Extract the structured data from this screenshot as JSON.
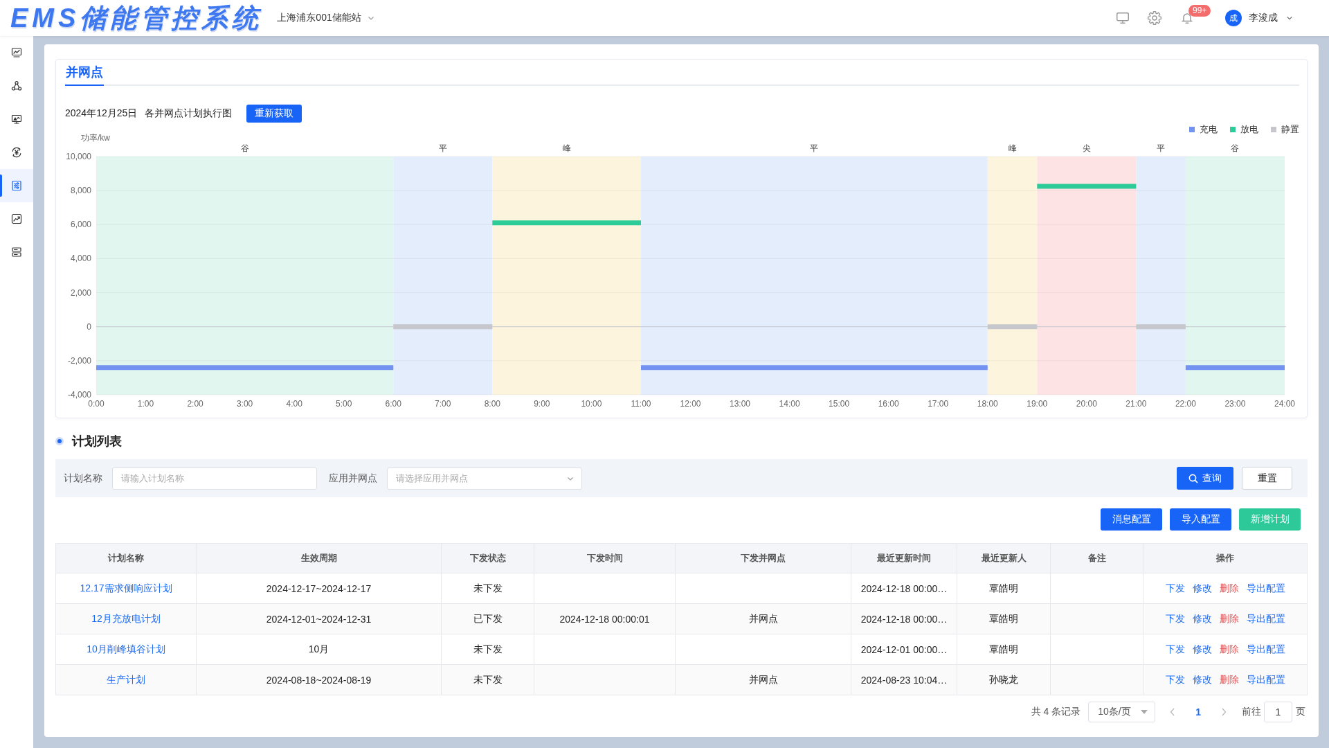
{
  "header": {
    "logo": "EMS储能管控系统",
    "station": "上海浦东001储能站",
    "notification_badge": "99+",
    "user": {
      "avatar": "成",
      "name": "李浚成"
    }
  },
  "sidebar": {
    "items": [
      {
        "selected": false
      },
      {
        "selected": false
      },
      {
        "selected": false
      },
      {
        "selected": false
      },
      {
        "selected": true
      },
      {
        "selected": false
      },
      {
        "selected": false
      }
    ]
  },
  "chart_panel": {
    "tabs": [
      {
        "label": "并网点",
        "selected": true
      }
    ],
    "date": "2024年12月25日",
    "subtitle": "各并网点计划执行图",
    "refresh_button": "重新获取",
    "chart_data": {
      "type": "line",
      "ylabel": "功率/kw",
      "x": [
        0,
        1,
        2,
        3,
        4,
        5,
        6,
        7,
        8,
        9,
        10,
        11,
        12,
        13,
        14,
        15,
        16,
        17,
        18,
        19,
        20,
        21,
        22,
        23,
        24
      ],
      "xlim": [
        0,
        24
      ],
      "ylim": [
        -4000,
        10000
      ],
      "grid": true,
      "xticks": [
        {
          "value": 0,
          "label": "0:00"
        },
        {
          "value": 1,
          "label": "1:00"
        },
        {
          "value": 2,
          "label": "2:00"
        },
        {
          "value": 3,
          "label": "3:00"
        },
        {
          "value": 4,
          "label": "4:00"
        },
        {
          "value": 5,
          "label": "5:00"
        },
        {
          "value": 6,
          "label": "6:00"
        },
        {
          "value": 7,
          "label": "7:00"
        },
        {
          "value": 8,
          "label": "8:00"
        },
        {
          "value": 9,
          "label": "9:00"
        },
        {
          "value": 10,
          "label": "10:00"
        },
        {
          "value": 11,
          "label": "11:00"
        },
        {
          "value": 12,
          "label": "12:00"
        },
        {
          "value": 13,
          "label": "13:00"
        },
        {
          "value": 14,
          "label": "14:00"
        },
        {
          "value": 15,
          "label": "15:00"
        },
        {
          "value": 16,
          "label": "16:00"
        },
        {
          "value": 17,
          "label": "17:00"
        },
        {
          "value": 18,
          "label": "18:00"
        },
        {
          "value": 19,
          "label": "19:00"
        },
        {
          "value": 20,
          "label": "20:00"
        },
        {
          "value": 21,
          "label": "21:00"
        },
        {
          "value": 22,
          "label": "22:00"
        },
        {
          "value": 23,
          "label": "23:00"
        },
        {
          "value": 24,
          "label": "24:00"
        }
      ],
      "yticks": [
        {
          "value": 10000,
          "label": "10,000"
        },
        {
          "value": 8000,
          "label": "8,000"
        },
        {
          "value": 6000,
          "label": "6,000"
        },
        {
          "value": 4000,
          "label": "4,000"
        },
        {
          "value": 2000,
          "label": "2,000"
        },
        0,
        {
          "value": -2000,
          "label": "-2,000"
        },
        {
          "value": -4000,
          "label": "-4,000"
        }
      ],
      "series": [
        {
          "name": "充电",
          "color": "#7393f2",
          "values": [
            -2400,
            -2400,
            -2400,
            -2400,
            -2400,
            -2400,
            -2400,
            null,
            null,
            null,
            null,
            -2400,
            -2400,
            -2400,
            -2400,
            -2400,
            -2400,
            -2400,
            -2400,
            null,
            null,
            null,
            -2400,
            -2400,
            -2400
          ]
        },
        {
          "name": "放电",
          "color": "#2dcb97",
          "values": [
            null,
            null,
            null,
            null,
            null,
            null,
            null,
            null,
            6100,
            6100,
            6100,
            6100,
            null,
            null,
            null,
            null,
            null,
            null,
            null,
            8250,
            8250,
            8250,
            null,
            null,
            null
          ]
        },
        {
          "name": "静置",
          "color": "#c6c7cc",
          "values": [
            null,
            null,
            null,
            null,
            null,
            null,
            0,
            0,
            0,
            null,
            null,
            null,
            null,
            null,
            null,
            null,
            null,
            null,
            0,
            0,
            null,
            0,
            0,
            null,
            null
          ]
        }
      ],
      "bands": [
        {
          "axis": "x",
          "label": "谷",
          "from": 0,
          "to": 6,
          "color": "#e1f6ee"
        },
        {
          "axis": "x",
          "label": "平",
          "from": 6,
          "to": 8,
          "color": "#e3edfb"
        },
        {
          "axis": "x",
          "label": "峰",
          "from": 8,
          "to": 11,
          "color": "#fdf4de"
        },
        {
          "axis": "x",
          "label": "平",
          "from": 11,
          "to": 18,
          "color": "#e3edfb"
        },
        {
          "axis": "x",
          "label": "峰",
          "from": 18,
          "to": 19,
          "color": "#fdf4de"
        },
        {
          "axis": "x",
          "label": "尖",
          "from": 19,
          "to": 21,
          "color": "#fde3e4"
        },
        {
          "axis": "x",
          "label": "平",
          "from": 21,
          "to": 22,
          "color": "#e3edfb"
        },
        {
          "axis": "x",
          "label": "谷",
          "from": 22,
          "to": 24,
          "color": "#e1f6ee"
        }
      ]
    }
  },
  "plan_list": {
    "title": "计划列表",
    "filters": [
      {
        "label": "计划名称",
        "placeholder": "请输入计划名称",
        "kind": "input"
      },
      {
        "label": "应用并网点",
        "placeholder": "请选择应用并网点",
        "kind": "select"
      }
    ],
    "search_button": "查询",
    "reset_button": "重置",
    "actions": [
      {
        "label": "消息配置",
        "kind": "primary"
      },
      {
        "label": "导入配置",
        "kind": "primary"
      },
      {
        "label": "新增计划",
        "kind": "success"
      }
    ],
    "table": {
      "columns": [
        "计划名称",
        "生效周期",
        "下发状态",
        "下发时间",
        "下发并网点",
        "最近更新时间",
        "最近更新人",
        "备注",
        "操作"
      ],
      "rows": [
        {
          "name": "12.17需求侧响应计划",
          "period": "2024-12-17~2024-12-17",
          "status": "未下发",
          "updated_at": "2024-12-18 00:00…",
          "updated_by": "覃皓明",
          "operations": [
            {
              "label": "下发",
              "kind": "link"
            },
            {
              "label": "修改",
              "kind": "link"
            },
            {
              "label": "删除",
              "kind": "danger"
            },
            {
              "label": "导出配置",
              "kind": "link"
            }
          ]
        },
        {
          "name": "12月充放电计划",
          "period": "2024-12-01~2024-12-31",
          "status": "已下发",
          "issue_time": "2024-12-18 00:00:01",
          "grid_point": "并网点",
          "updated_at": "2024-12-18 00:00…",
          "updated_by": "覃皓明",
          "operations": [
            {
              "label": "下发",
              "kind": "link"
            },
            {
              "label": "修改",
              "kind": "link"
            },
            {
              "label": "删除",
              "kind": "danger"
            },
            {
              "label": "导出配置",
              "kind": "link"
            }
          ]
        },
        {
          "name": "10月削峰填谷计划",
          "period": "10月",
          "status": "未下发",
          "updated_at": "2024-12-01 00:00…",
          "updated_by": "覃皓明",
          "operations": [
            {
              "label": "下发",
              "kind": "link"
            },
            {
              "label": "修改",
              "kind": "link"
            },
            {
              "label": "删除",
              "kind": "danger"
            },
            {
              "label": "导出配置",
              "kind": "link"
            }
          ]
        },
        {
          "name": "生产计划",
          "period": "2024-08-18~2024-08-19",
          "status": "未下发",
          "grid_point": "并网点",
          "updated_at": "2024-08-23 10:04…",
          "updated_by": "孙晓龙",
          "operations": [
            {
              "label": "下发",
              "kind": "link"
            },
            {
              "label": "修改",
              "kind": "link"
            },
            {
              "label": "删除",
              "kind": "danger"
            },
            {
              "label": "导出配置",
              "kind": "link"
            }
          ]
        }
      ]
    },
    "pagination": {
      "total": "共 4 条记录",
      "page_size": "10条/页",
      "pages": [
        {
          "label": "1",
          "selected": true
        }
      ],
      "jump_label": "前往",
      "jump_value": "1",
      "page_unit": "页"
    }
  }
}
